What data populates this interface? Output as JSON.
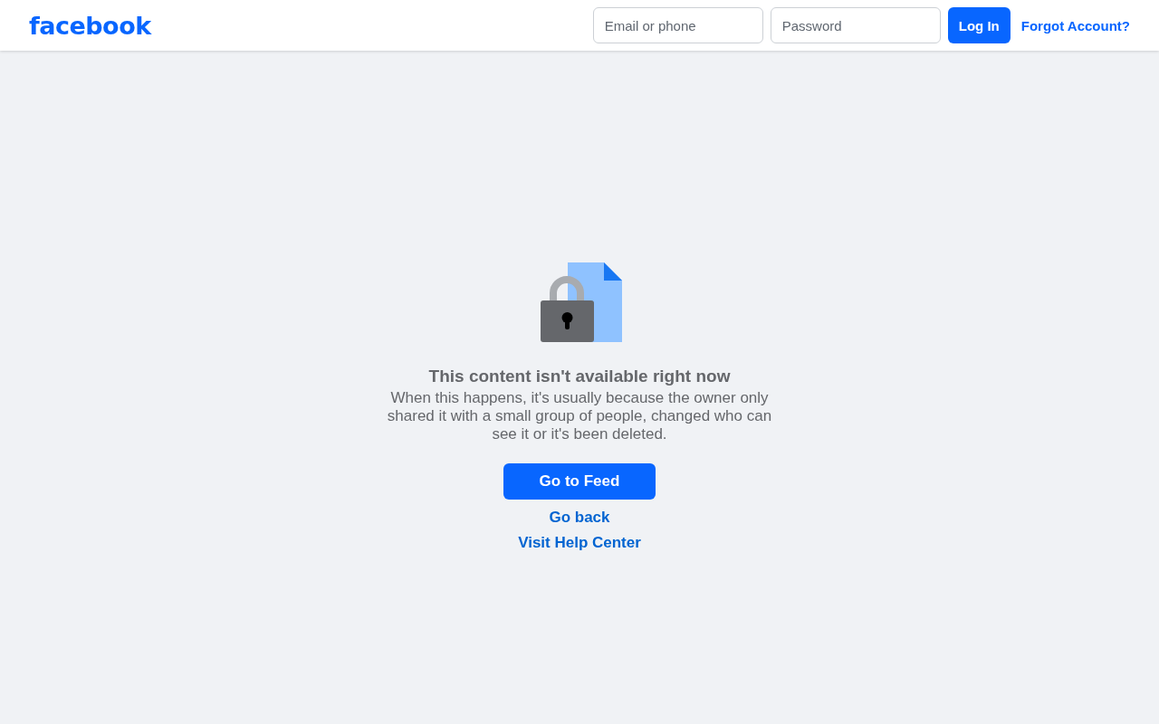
{
  "header": {
    "logo": "facebook",
    "email": {
      "placeholder": "Email or phone"
    },
    "password": {
      "placeholder": "Password"
    },
    "login_button": "Log In",
    "forgot_link": "Forgot Account?"
  },
  "message": {
    "title": "This content isn't available right now",
    "body": "When this happens, it's usually because the owner only shared it with a small group of people, changed who can see it or it's been deleted.",
    "primary_button": "Go to Feed",
    "links": [
      "Go back",
      "Visit Help Center"
    ]
  }
}
